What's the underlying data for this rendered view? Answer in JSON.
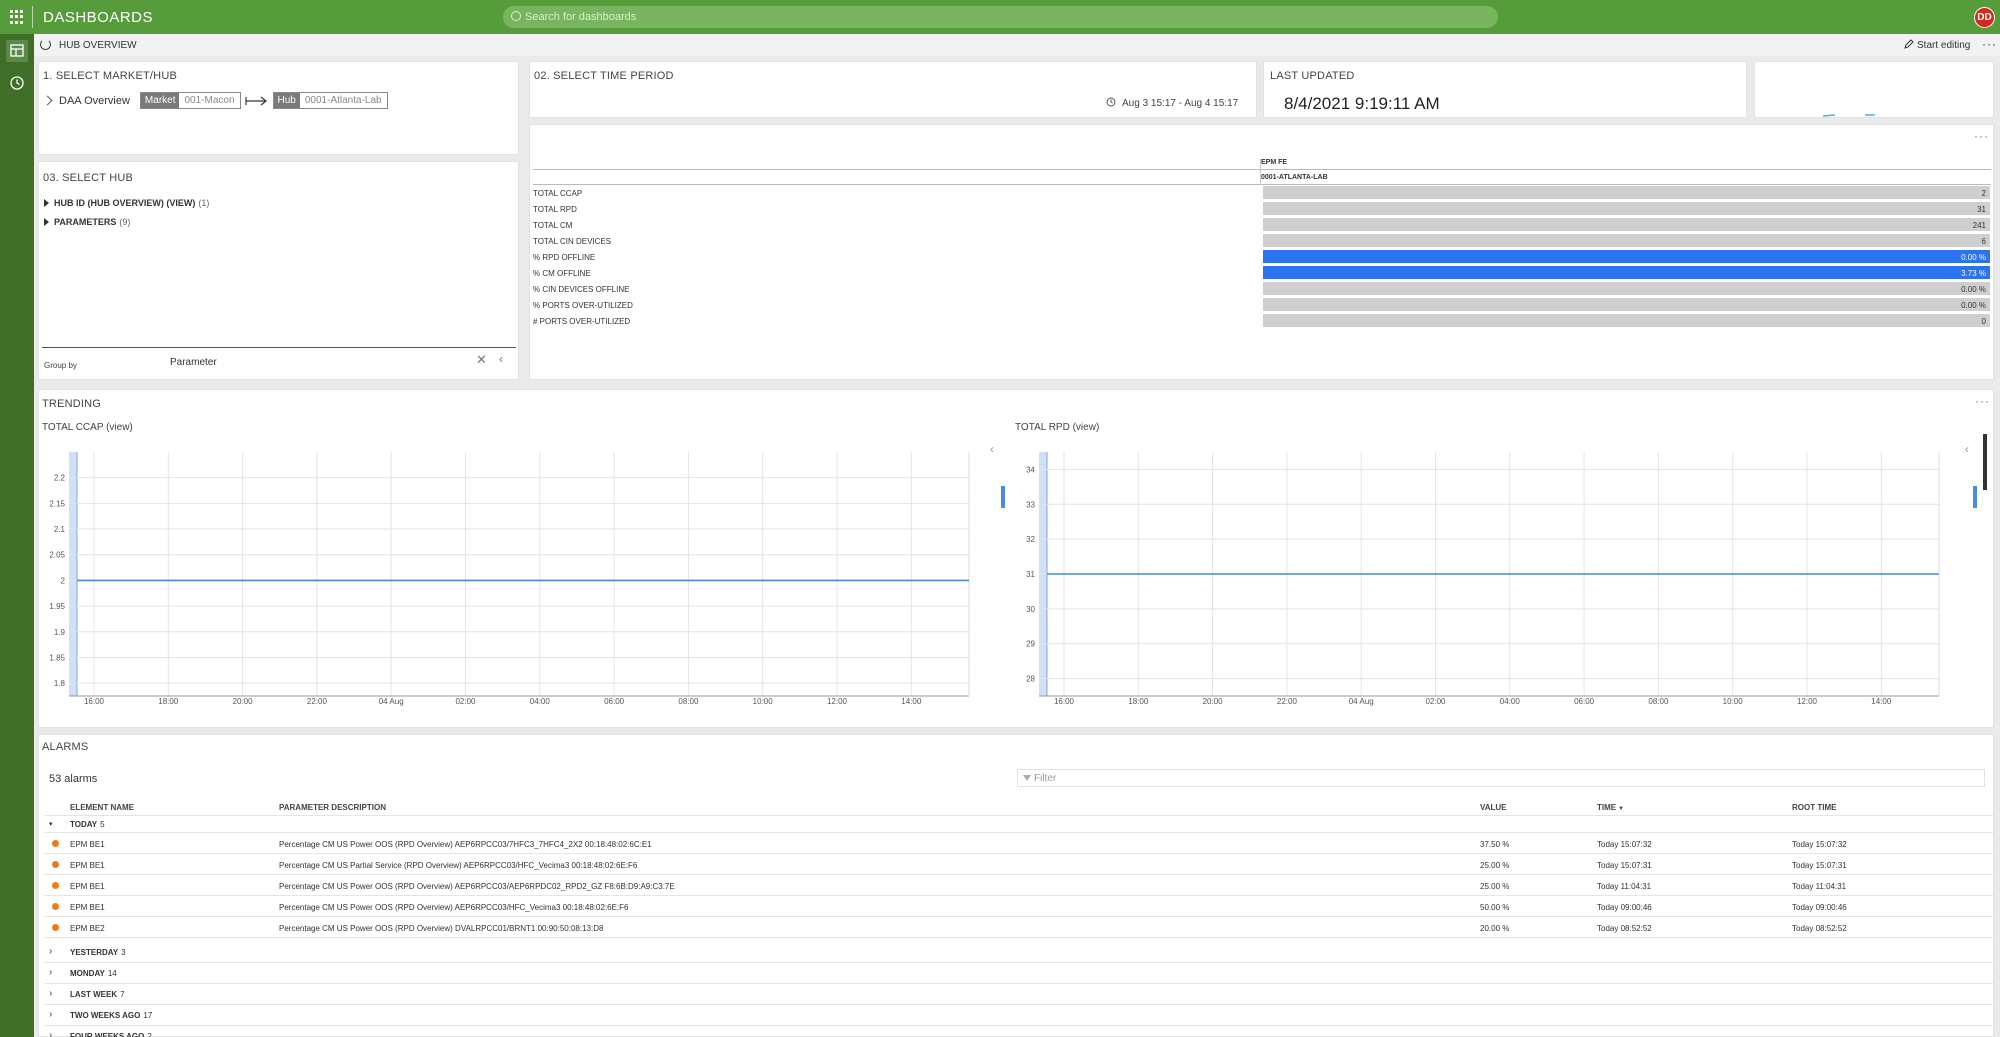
{
  "topbar": {
    "title": "DASHBOARDS",
    "search_placeholder": "Search for dashboards",
    "avatar_initials": "DD"
  },
  "subheader": {
    "page_title": "HUB OVERVIEW",
    "edit_label": "Start editing",
    "more": "···"
  },
  "select_market": {
    "title": "1. SELECT MARKET/HUB",
    "root": "DAA Overview",
    "market_key": "Market",
    "market_value": "001-Macon",
    "hub_key": "Hub",
    "hub_value": "0001-Atlanta-Lab"
  },
  "time_period": {
    "title": "02. SELECT TIME PERIOD",
    "range": "Aug 3 15:17 - Aug 4 15:17"
  },
  "last_updated": {
    "title": "LAST UPDATED",
    "value": "8/4/2021 9:19:11 AM"
  },
  "select_hub": {
    "title": "03. SELECT HUB",
    "items": [
      {
        "label": "HUB ID (HUB OVERVIEW) (VIEW)",
        "count": "(1)"
      },
      {
        "label": "PARAMETERS",
        "count": "(9)"
      }
    ],
    "groupby_label": "Group by",
    "groupby_value": "Parameter"
  },
  "kpi": {
    "column_header": "EPM FE",
    "column_sub": "0001-ATLANTA-LAB",
    "rows": [
      {
        "label": "TOTAL CCAP",
        "value": "2",
        "highlight": false
      },
      {
        "label": "TOTAL RPD",
        "value": "31",
        "highlight": false
      },
      {
        "label": "TOTAL CM",
        "value": "241",
        "highlight": false
      },
      {
        "label": "TOTAL CIN DEVICES",
        "value": "6",
        "highlight": false
      },
      {
        "label": "% RPD OFFLINE",
        "value": "0.00 %",
        "highlight": true
      },
      {
        "label": "% CM OFFLINE",
        "value": "3.73 %",
        "highlight": true
      },
      {
        "label": "% CIN DEVICES OFFLINE",
        "value": "0.00 %",
        "highlight": false
      },
      {
        "label": "% PORTS OVER-UTILIZED",
        "value": "0.00 %",
        "highlight": false
      },
      {
        "label": "# PORTS OVER-UTILIZED",
        "value": "0",
        "highlight": false
      }
    ]
  },
  "trending": {
    "title": "TRENDING"
  },
  "chart_data": [
    {
      "type": "line",
      "title": "TOTAL CCAP (view)",
      "xlabel": "",
      "ylabel": "",
      "x_ticks": [
        "16:00",
        "18:00",
        "20:00",
        "22:00",
        "04 Aug",
        "02:00",
        "04:00",
        "06:00",
        "08:00",
        "10:00",
        "12:00",
        "14:00"
      ],
      "y_ticks": [
        "2.2",
        "2.15",
        "2.1",
        "2.05",
        "2",
        "1.95",
        "1.9",
        "1.85",
        "1.8"
      ],
      "ylim": [
        1.775,
        2.25
      ],
      "x": [
        "Aug 3 15:17",
        "Aug 4 15:17"
      ],
      "series": [
        {
          "values": [
            2,
            2
          ]
        }
      ],
      "grid": true
    },
    {
      "type": "line",
      "title": "TOTAL RPD (view)",
      "xlabel": "",
      "ylabel": "",
      "x_ticks": [
        "16:00",
        "18:00",
        "20:00",
        "22:00",
        "04 Aug",
        "02:00",
        "04:00",
        "06:00",
        "08:00",
        "10:00",
        "12:00",
        "14:00"
      ],
      "y_ticks": [
        "34",
        "33",
        "32",
        "31",
        "30",
        "29",
        "28"
      ],
      "ylim": [
        27.5,
        34.5
      ],
      "x": [
        "Aug 3 15:17",
        "Aug 4 15:17"
      ],
      "series": [
        {
          "values": [
            31,
            31
          ]
        }
      ],
      "grid": true
    }
  ],
  "alarms": {
    "title": "ALARMS",
    "count_label": "53 alarms",
    "filter_placeholder": "Filter",
    "columns": {
      "element": "ELEMENT NAME",
      "param": "PARAMETER DESCRIPTION",
      "value": "VALUE",
      "time": "TIME",
      "root": "ROOT TIME"
    },
    "today": {
      "label": "TODAY",
      "count": "5"
    },
    "rows": [
      {
        "element": "EPM BE1",
        "param": "Percentage CM US Power OOS (RPD Overview) AEP6RPCC03/7HFC3_7HFC4_2X2 00:18:48:02:6C:E1",
        "value": "37.50 %",
        "time": "Today 15:07:32",
        "root": "Today 15:07:32"
      },
      {
        "element": "EPM BE1",
        "param": "Percentage CM US Partial Service (RPD Overview) AEP6RPCC03/HFC_Vecima3 00:18:48:02:6E:F6",
        "value": "25.00 %",
        "time": "Today 15:07:31",
        "root": "Today 15:07:31"
      },
      {
        "element": "EPM BE1",
        "param": "Percentage CM US Power OOS (RPD Overview) AEP6RPCC03/AEP6RPDC02_RPD2_GZ F8:6B:D9:A9:C3:7E",
        "value": "25.00 %",
        "time": "Today 11:04:31",
        "root": "Today 11:04:31"
      },
      {
        "element": "EPM BE1",
        "param": "Percentage CM US Power OOS (RPD Overview) AEP6RPCC03/HFC_Vecima3 00:18:48:02:6E:F6",
        "value": "50.00 %",
        "time": "Today 09:00:46",
        "root": "Today 09:00:46"
      },
      {
        "element": "EPM BE2",
        "param": "Percentage CM US Power OOS (RPD Overview) DVALRPCC01/BRNT1 00:90:50:08:13:D8",
        "value": "20.00 %",
        "time": "Today 08:52:52",
        "root": "Today 08:52:52"
      }
    ],
    "groups": [
      {
        "label": "YESTERDAY",
        "count": "3"
      },
      {
        "label": "MONDAY",
        "count": "14"
      },
      {
        "label": "LAST WEEK",
        "count": "7"
      },
      {
        "label": "TWO WEEKS AGO",
        "count": "17"
      },
      {
        "label": "FOUR WEEKS AGO",
        "count": "2"
      }
    ]
  }
}
